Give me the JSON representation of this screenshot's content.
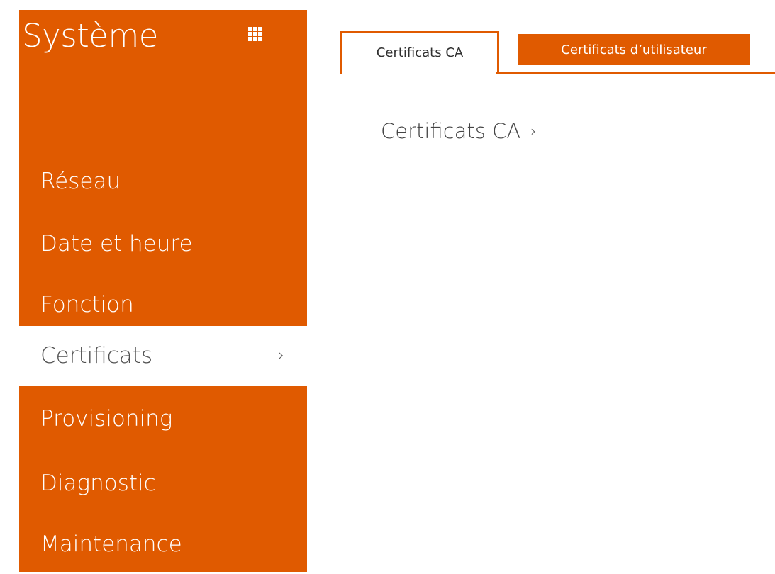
{
  "sidebar": {
    "title": "Système",
    "apps_icon": "grid-icon",
    "items": [
      {
        "label": "Réseau",
        "active": false
      },
      {
        "label": "Date et heure",
        "active": false
      },
      {
        "label": "Fonction",
        "active": false
      },
      {
        "label": "Certificats",
        "active": true,
        "chevron": "›"
      },
      {
        "label": "Provisioning",
        "active": false
      },
      {
        "label": "Diagnostic",
        "active": false
      },
      {
        "label": "Maintenance",
        "active": false
      }
    ]
  },
  "tabs": [
    {
      "label": "Certificats CA",
      "active": true
    },
    {
      "label": "Certificats d’utilisateur",
      "active": false
    }
  ],
  "main": {
    "section_title": "Certificats CA",
    "section_chevron": "›"
  },
  "colors": {
    "accent": "#e05a00",
    "text_dark": "#444444",
    "background": "#ffffff"
  }
}
